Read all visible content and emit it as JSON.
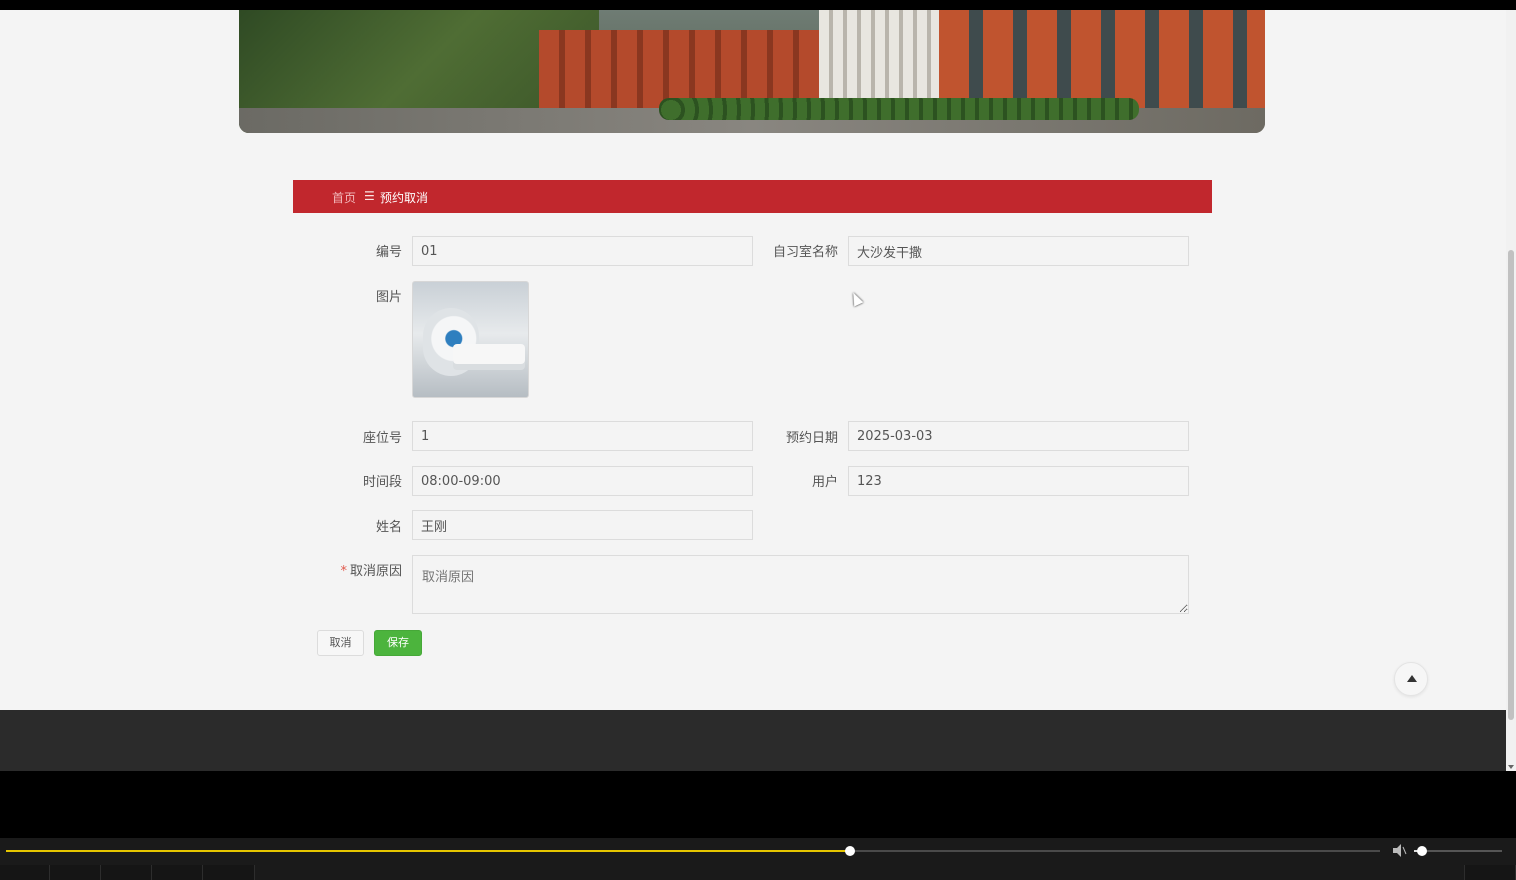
{
  "breadcrumb": {
    "home": "首页",
    "separator": "☰",
    "current": "预约取消"
  },
  "form": {
    "id_label": "编号",
    "id_value": "01",
    "room_label": "自习室名称",
    "room_value": "大沙发干撒",
    "picture_label": "图片",
    "seat_label": "座位号",
    "seat_value": "1",
    "date_label": "预约日期",
    "date_value": "2025-03-03",
    "time_label": "时间段",
    "time_value": "08:00-09:00",
    "user_label": "用户",
    "user_value": "123",
    "name_label": "姓名",
    "name_value": "王刚",
    "reason_label": "取消原因",
    "reason_required_mark": "*",
    "reason_placeholder": "取消原因"
  },
  "buttons": {
    "cancel": "取消",
    "save": "保存"
  },
  "icons": {
    "back_to_top": "arrow-up-icon",
    "volume": "volume-icon"
  },
  "player": {
    "progress": 0.6142,
    "volume": 0.09
  },
  "colors": {
    "accent": "#c1272d",
    "save": "#4cb43d",
    "progress": "#e5c500"
  }
}
